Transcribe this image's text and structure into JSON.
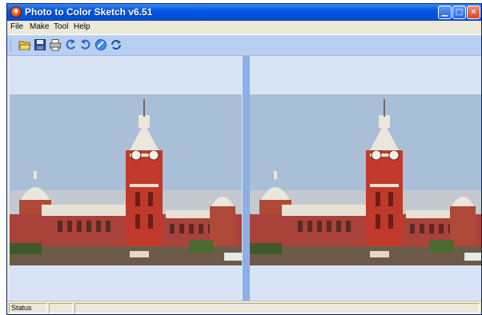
{
  "window": {
    "title": "Photo to Color Sketch v6.51"
  },
  "title_buttons": {
    "minimize": "minimize",
    "maximize": "maximize",
    "close": "close"
  },
  "menu": [
    {
      "label": "File"
    },
    {
      "label": "Make"
    },
    {
      "label": "Tool"
    },
    {
      "label": "Help"
    }
  ],
  "toolbar": {
    "icons": [
      "open-folder-icon",
      "save-disk-icon",
      "print-icon",
      "rotate-left-icon",
      "rotate-right-icon",
      "make-sketch-icon",
      "refresh-icon"
    ]
  },
  "panes": {
    "left": {
      "image": "clock-tower-building-photo"
    },
    "right": {
      "image": "clock-tower-building-sketch-preview"
    }
  },
  "colors": {
    "titlebar": "#0054e3",
    "toolbar": "#b8cff2",
    "client": "#d8e4f6",
    "splitter": "#8eaee6",
    "sky": "#a9bfd8",
    "brick": "#b04a38"
  },
  "status": {
    "text": "Status",
    "cell2": "",
    "cell3": ""
  }
}
